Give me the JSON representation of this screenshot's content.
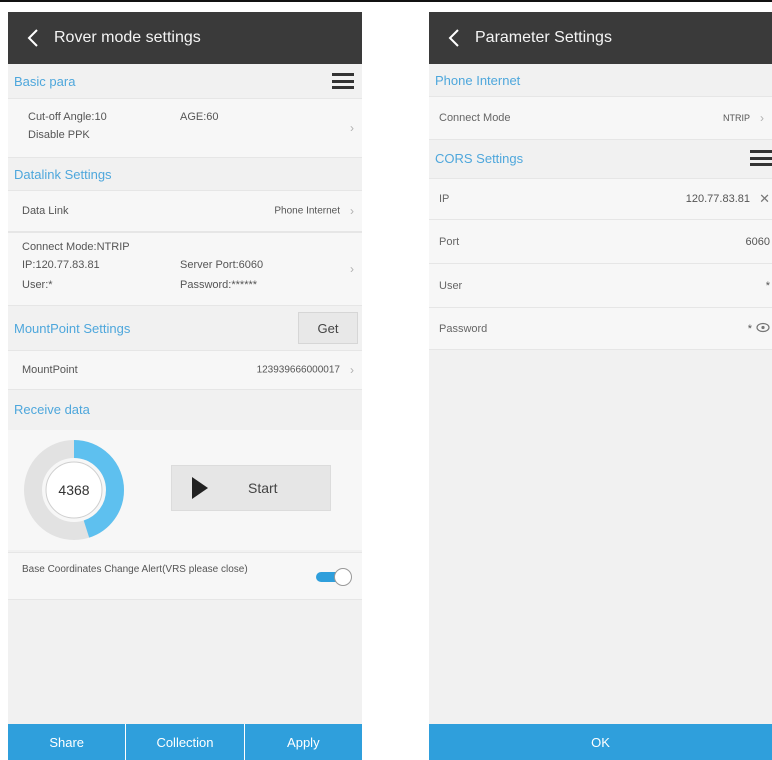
{
  "left": {
    "title": "Rover mode settings",
    "basic": {
      "header": "Basic para",
      "cutoff": "Cut-off Angle:10",
      "age": "AGE:60",
      "ppk": "Disable PPK"
    },
    "datalink": {
      "header": "Datalink Settings",
      "label": "Data Link",
      "value": "Phone Internet",
      "connect_mode": "Connect Mode:NTRIP",
      "ip": "IP:120.77.83.81",
      "server_port": "Server Port:6060",
      "user": "User:*",
      "password": "Password:******"
    },
    "mountpoint": {
      "header": "MountPoint Settings",
      "get_label": "Get",
      "label": "MountPoint",
      "value": "123939666000017"
    },
    "receive": {
      "header": "Receive data",
      "count": "4368",
      "progress": 0.45,
      "start_label": "Start"
    },
    "alert": {
      "text": "Base Coordinates Change Alert(VRS please close)",
      "enabled": true
    },
    "bottom": [
      "Share",
      "Collection",
      "Apply"
    ]
  },
  "right": {
    "title": "Parameter Settings",
    "phone_header": "Phone Internet",
    "connect_mode_label": "Connect Mode",
    "connect_mode_value": "NTRIP",
    "cors_header": "CORS Settings",
    "ip_label": "IP",
    "ip_value": "120.77.83.81",
    "port_label": "Port",
    "port_value": "6060",
    "user_label": "User",
    "user_value": "*",
    "password_label": "Password",
    "password_value": "*",
    "ok_label": "OK"
  },
  "colors": {
    "accent": "#2f9fdc",
    "section_text": "#4ea7dc",
    "titlebar": "#3a3a3a"
  }
}
